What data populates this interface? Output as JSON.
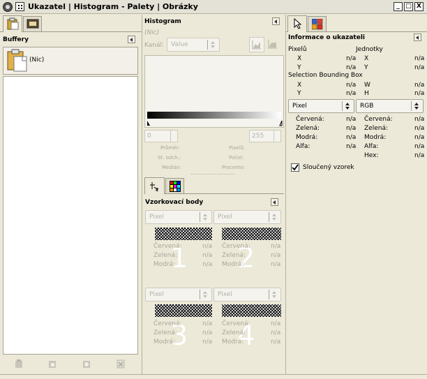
{
  "window": {
    "title": "Ukazatel | Histogram - Palety | Obrázky",
    "minimize_label": "_",
    "maximize_label": "□",
    "close_label": "X"
  },
  "left": {
    "section_title": "Buffery",
    "buffer_item": "(Nic)",
    "footer_icons": [
      "paste-icon",
      "paste-into-icon",
      "paste-as-new-icon",
      "delete-buffer-icon"
    ]
  },
  "histogram": {
    "title": "Histogram",
    "subtitle": "(Nic)",
    "channel_label": "Kanál:",
    "channel_value": "Value",
    "range_start": "0",
    "range_end": "255",
    "stats": {
      "mean": "Průměr:",
      "std": "St. odch.:",
      "median": "Medián:",
      "pixels": "Pixelů:",
      "count": "Počet:",
      "percentile": "Procento:"
    }
  },
  "sample_points": {
    "title": "Vzorkovací body",
    "points": [
      {
        "number": "1",
        "mode": "Pixel",
        "red": "Červená:",
        "green": "Zelená:",
        "blue": "Modrá:",
        "red_val": "n/a",
        "green_val": "n/a",
        "blue_val": "n/a"
      },
      {
        "number": "2",
        "mode": "Pixel",
        "red": "Červená:",
        "green": "Zelená:",
        "blue": "Modrá:",
        "red_val": "n/a",
        "green_val": "n/a",
        "blue_val": "n/a"
      },
      {
        "number": "3",
        "mode": "Pixel",
        "red": "Červená:",
        "green": "Zelená:",
        "blue": "Modrá:",
        "red_val": "n/a",
        "green_val": "n/a",
        "blue_val": "n/a"
      },
      {
        "number": "4",
        "mode": "Pixel",
        "red": "Červená:",
        "green": "Zelená:",
        "blue": "Modrá:",
        "red_val": "n/a",
        "green_val": "n/a",
        "blue_val": "n/a"
      }
    ]
  },
  "pointer": {
    "title": "Informace o ukazateli",
    "pixels_label": "Pixelů",
    "units_label": "Jednotky",
    "x": "X",
    "y": "Y",
    "na": "n/a",
    "bbox_label": "Selection Bounding Box",
    "w": "W",
    "h": "H",
    "mode_left": "Pixel",
    "mode_right": "RGB",
    "red": "Červená:",
    "green": "Zelená:",
    "blue": "Modrá:",
    "alpha_left": "Alfa:",
    "alpha_right": "Alfa:",
    "hex": "Hex:",
    "sample_merged": "Sloučený vzorek"
  }
}
